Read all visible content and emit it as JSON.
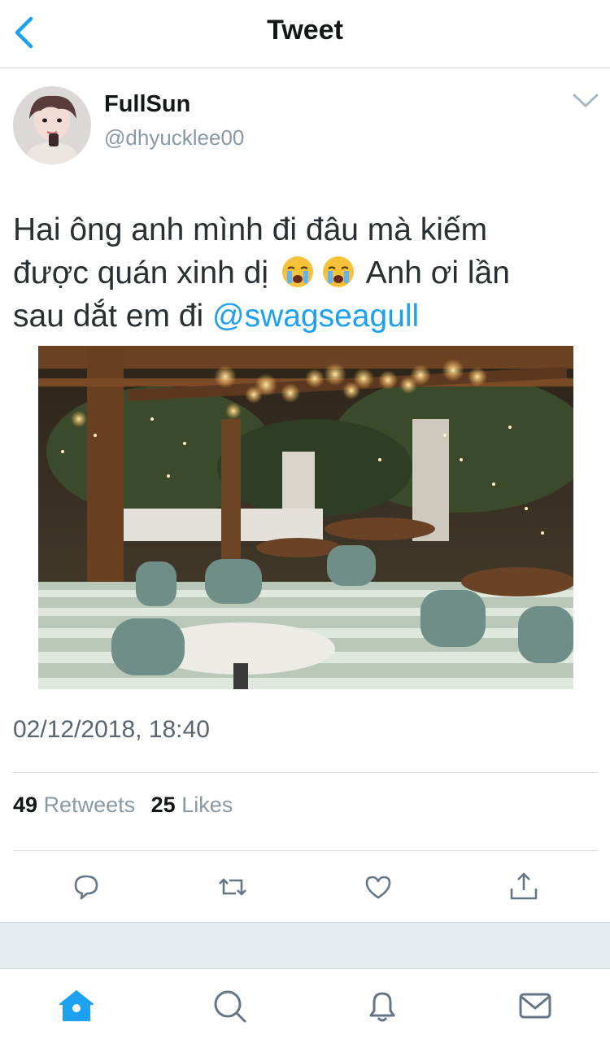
{
  "nav": {
    "title": "Tweet",
    "back_icon": "chevron-left-icon"
  },
  "author": {
    "name": "FullSun",
    "handle": "@dhyucklee00"
  },
  "tweet": {
    "line1": "Hai ông anh mình đi đâu mà kiếm",
    "line2_a": "được quán xinh dị",
    "line2_b": "Anh ơi lần",
    "line3_a": "sau dắt em đi",
    "mention": "@swagseagull",
    "emoji": "crying-face-emoji"
  },
  "timestamp": "02/12/2018, 18:40",
  "stats": {
    "retweets_count": "49",
    "retweets_label": "Retweets",
    "likes_count": "25",
    "likes_label": "Likes"
  },
  "actions": [
    "reply-icon",
    "retweet-icon",
    "like-icon",
    "share-icon"
  ],
  "tabs": [
    "home-icon",
    "search-icon",
    "notifications-icon",
    "messages-icon"
  ],
  "colors": {
    "accent": "#1da1f2",
    "text": "#14171a",
    "muted": "#8899a6",
    "band": "#e6ecf0"
  }
}
